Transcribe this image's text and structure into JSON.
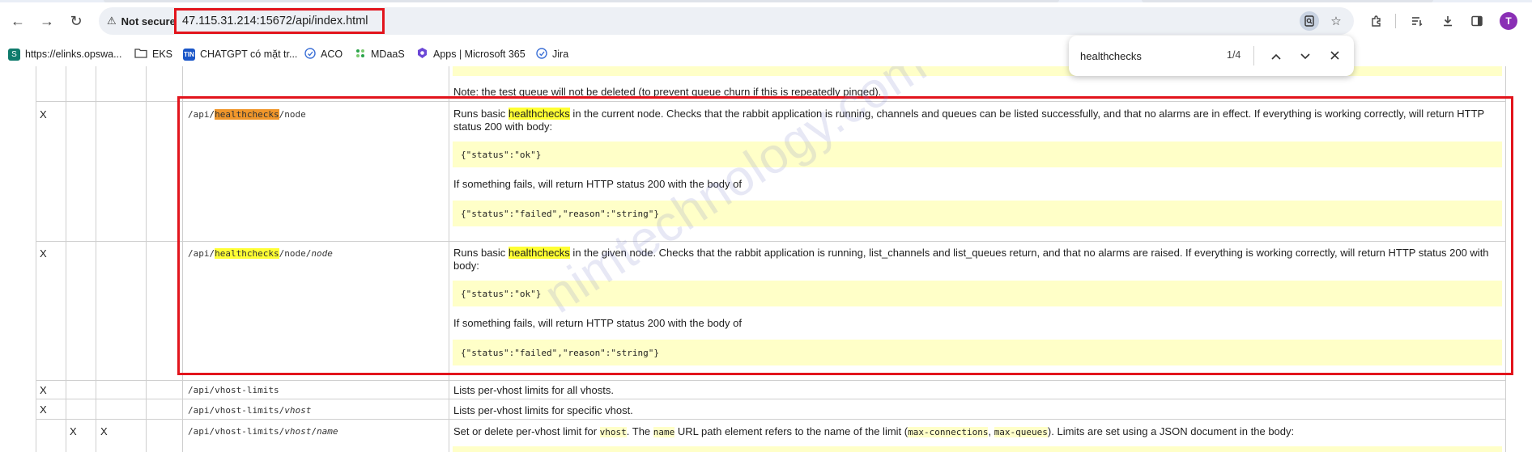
{
  "browser": {
    "security_label": "Not secure",
    "url": "47.115.31.214:15672/api/index.html",
    "avatar_letter": "T"
  },
  "bookmarks": [
    {
      "label": "https://elinks.opswa...",
      "icon": "sharepoint-icon",
      "color": "#0f7b6c"
    },
    {
      "label": "EKS",
      "icon": "folder-icon",
      "color": "#555555"
    },
    {
      "label": "CHATGPT có mặt tr...",
      "icon": "tintuc-icon",
      "color": "#1a56c8"
    },
    {
      "label": "ACO",
      "icon": "globe-icon",
      "color": "#3b6fd6"
    },
    {
      "label": "MDaaS",
      "icon": "grid-icon",
      "color": "#2aa34a"
    },
    {
      "label": "Apps | Microsoft 365",
      "icon": "m365-icon",
      "color": "#6b47d6"
    },
    {
      "label": "Jira",
      "icon": "globe-icon",
      "color": "#3b6fd6"
    }
  ],
  "find": {
    "query": "healthchecks",
    "count": "1/4"
  },
  "table": {
    "top_note": "Note: the test queue will not be deleted (to prevent queue churn if this is repeatedly pinged).",
    "rows": [
      {
        "get": "X",
        "path_prefix": "/api/",
        "path_hl": "healthchecks",
        "path_suffix": "/node",
        "desc_pre": "Runs basic ",
        "desc_hl": "healthchecks",
        "desc_post": " in the current node. Checks that the rabbit application is running, channels and queues can be listed successfully, and that no alarms are in effect. If everything is working correctly, will return HTTP status 200 with body:",
        "code_ok": "{\"status\":\"ok\"}",
        "fail_text": "If something fails, will return HTTP status 200 with the body of",
        "code_fail": "{\"status\":\"failed\",\"reason\":\"string\"}"
      },
      {
        "get": "X",
        "path_prefix": "/api/",
        "path_hl": "healthchecks",
        "path_suffix": "/node/",
        "path_var": "node",
        "desc_pre": "Runs basic ",
        "desc_hl": "healthchecks",
        "desc_post": " in the given node. Checks that the rabbit application is running, list_channels and list_queues return, and that no alarms are raised. If everything is working correctly, will return HTTP status 200 with body:",
        "code_ok": "{\"status\":\"ok\"}",
        "fail_text": "If something fails, will return HTTP status 200 with the body of",
        "code_fail": "{\"status\":\"failed\",\"reason\":\"string\"}"
      },
      {
        "get": "X",
        "path": "/api/vhost-limits",
        "desc": "Lists per-vhost limits for all vhosts."
      },
      {
        "get": "X",
        "path_prefix": "/api/vhost-limits/",
        "path_var": "vhost",
        "desc": "Lists per-vhost limits for specific vhost."
      },
      {
        "put": "X",
        "delete": "X",
        "path_prefix": "/api/vhost-limits/",
        "path_var": "vhost",
        "path_mid": "/",
        "path_var2": "name",
        "desc_a": "Set or delete per-vhost limit for ",
        "desc_code1": "vhost",
        "desc_b": ". The ",
        "desc_code2": "name",
        "desc_c": " URL path element refers to the name of the limit (",
        "desc_code3": "max-connections",
        "desc_d": ", ",
        "desc_code4": "max-queues",
        "desc_e": "). Limits are set using a JSON document in the body:"
      }
    ]
  },
  "watermark": "nimtechnology.com"
}
